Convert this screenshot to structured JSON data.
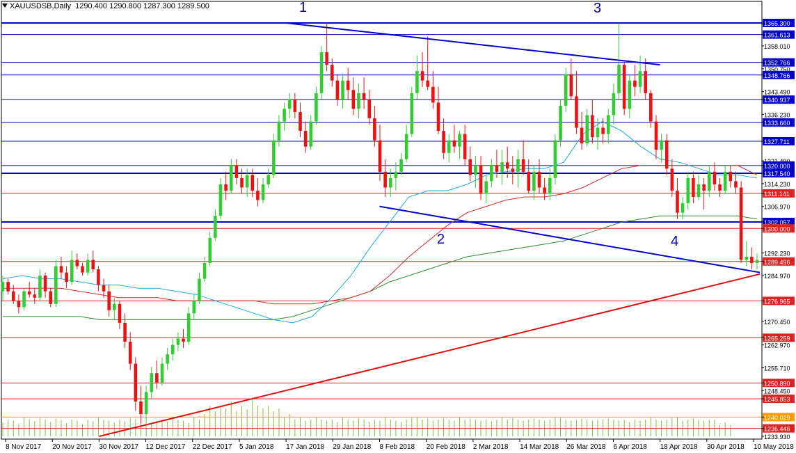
{
  "header": {
    "symbol": "XAUUSDSB,Daily",
    "ohlc": "1290.400 1290.800 1287.300 1289.500"
  },
  "annotations": {
    "a1": "1",
    "a2": "2",
    "a3": "3",
    "a4": "4"
  },
  "chart_data": {
    "type": "candlestick",
    "title": "XAUUSDSB,Daily",
    "ylim": [
      1233.93,
      1365.3
    ],
    "y_ticks": [
      "1365.300",
      "1361.613",
      "1358.010",
      "1352.766",
      "1350.750",
      "1348.766",
      "1343.490",
      "1340.937",
      "1336.230",
      "1333.660",
      "1327.711",
      "1321.490",
      "1320.000",
      "1317.540",
      "1314.230",
      "1311.141",
      "1306.970",
      "1302.057",
      "1300.000",
      "1292.230",
      "1289.496",
      "1284.970",
      "1276.965",
      "1270.450",
      "1265.259",
      "1262.970",
      "1255.710",
      "1250.890",
      "1248.450",
      "1245.853",
      "1240.029",
      "1236.446",
      "1233.930"
    ],
    "x_labels": [
      "8 Nov 2017",
      "20 Nov 2017",
      "30 Nov 2017",
      "12 Dec 2017",
      "22 Dec 2017",
      "5 Jan 2018",
      "17 Jan 2018",
      "29 Jan 2018",
      "8 Feb 2018",
      "20 Feb 2018",
      "2 Mar 2018",
      "14 Mar 2018",
      "26 Mar 2018",
      "6 Apr 2018",
      "18 Apr 2018",
      "30 Apr 2018",
      "10 May 2018"
    ],
    "current_price": 1289.5,
    "horizontal_levels": {
      "blue": [
        1365.3,
        1361.613,
        1352.766,
        1348.766,
        1340.937,
        1333.66,
        1327.711,
        1320.0,
        1317.54,
        1302.057
      ],
      "red": [
        1311.141,
        1300.0,
        1289.496,
        1276.965,
        1265.259,
        1250.89,
        1245.853,
        1236.446
      ],
      "orange": [
        1240.029
      ]
    },
    "trendlines": [
      {
        "color": "blue",
        "from": [
          "17 Jan 2018",
          1365.3
        ],
        "to": [
          "18 Apr 2018",
          1352.0
        ]
      },
      {
        "color": "blue",
        "from": [
          "8 Feb 2018",
          1307.0
        ],
        "to": [
          "17 May 2018",
          1286.0
        ]
      },
      {
        "color": "red",
        "from": [
          "30 Nov 2017",
          1233.9
        ],
        "to": [
          "17 May 2018",
          1285.5
        ]
      }
    ],
    "moving_averages": {
      "colors": {
        "fast": "#1fa9e1",
        "mid": "#d42a2a",
        "slow": "#2e8b2e"
      },
      "fast": [
        1284,
        1285,
        1284,
        1284,
        1283,
        1282,
        1282,
        1281,
        1281,
        1280,
        1279,
        1277,
        1275,
        1273,
        1271,
        1270,
        1272,
        1278,
        1285,
        1294,
        1302,
        1310,
        1312,
        1312,
        1314,
        1317,
        1318,
        1319,
        1319,
        1321,
        1330,
        1334,
        1331,
        1326,
        1322,
        1321,
        1319,
        1317,
        1317,
        1316
      ],
      "mid": [
        1281,
        1281,
        1281,
        1281,
        1280,
        1279,
        1278,
        1278,
        1278,
        1277,
        1277,
        1277,
        1277,
        1277,
        1276,
        1276,
        1276,
        1277,
        1278,
        1280,
        1285,
        1291,
        1296,
        1301,
        1305,
        1307,
        1309,
        1310,
        1310,
        1311,
        1313,
        1316,
        1319,
        1320,
        1320,
        1320,
        1320,
        1320,
        1320,
        1317
      ],
      "slow": [
        1272,
        1272,
        1272,
        1272,
        1272,
        1271,
        1271,
        1271,
        1271,
        1271,
        1271,
        1271,
        1271,
        1271,
        1271,
        1272,
        1274,
        1276,
        1278,
        1280,
        1283,
        1285,
        1287,
        1289,
        1291,
        1292,
        1293,
        1294,
        1295,
        1296,
        1298,
        1300,
        1302,
        1303,
        1304,
        1304,
        1304,
        1304,
        1304,
        1303
      ]
    },
    "candles": [
      [
        1280,
        1285,
        1277,
        1283
      ],
      [
        1283,
        1284,
        1279,
        1280
      ],
      [
        1280,
        1282,
        1276,
        1277
      ],
      [
        1277,
        1279,
        1273,
        1275
      ],
      [
        1275,
        1281,
        1274,
        1280
      ],
      [
        1280,
        1283,
        1278,
        1279
      ],
      [
        1279,
        1281,
        1276,
        1278
      ],
      [
        1278,
        1287,
        1277,
        1285
      ],
      [
        1285,
        1286,
        1278,
        1280
      ],
      [
        1280,
        1281,
        1275,
        1276
      ],
      [
        1276,
        1290,
        1275,
        1288
      ],
      [
        1288,
        1291,
        1284,
        1286
      ],
      [
        1286,
        1288,
        1281,
        1283
      ],
      [
        1283,
        1293,
        1282,
        1290
      ],
      [
        1290,
        1292,
        1287,
        1288
      ],
      [
        1288,
        1289,
        1285,
        1286
      ],
      [
        1286,
        1292,
        1285,
        1290
      ],
      [
        1290,
        1293,
        1286,
        1287
      ],
      [
        1287,
        1288,
        1280,
        1282
      ],
      [
        1282,
        1284,
        1278,
        1280
      ],
      [
        1280,
        1282,
        1272,
        1274
      ],
      [
        1274,
        1278,
        1271,
        1276
      ],
      [
        1276,
        1277,
        1268,
        1270
      ],
      [
        1270,
        1273,
        1262,
        1264
      ],
      [
        1264,
        1267,
        1255,
        1257
      ],
      [
        1257,
        1259,
        1242,
        1245
      ],
      [
        1245,
        1250,
        1238,
        1241
      ],
      [
        1241,
        1250,
        1239,
        1248
      ],
      [
        1248,
        1256,
        1246,
        1254
      ],
      [
        1254,
        1258,
        1249,
        1251
      ],
      [
        1251,
        1259,
        1250,
        1257
      ],
      [
        1257,
        1262,
        1255,
        1260
      ],
      [
        1260,
        1265,
        1258,
        1263
      ],
      [
        1263,
        1267,
        1261,
        1265
      ],
      [
        1265,
        1268,
        1262,
        1264
      ],
      [
        1264,
        1275,
        1263,
        1273
      ],
      [
        1273,
        1279,
        1271,
        1277
      ],
      [
        1277,
        1286,
        1276,
        1284
      ],
      [
        1284,
        1291,
        1283,
        1289
      ],
      [
        1289,
        1299,
        1288,
        1297
      ],
      [
        1297,
        1306,
        1296,
        1304
      ],
      [
        1304,
        1316,
        1303,
        1314
      ],
      [
        1314,
        1318,
        1309,
        1312
      ],
      [
        1312,
        1322,
        1311,
        1320
      ],
      [
        1320,
        1322,
        1314,
        1316
      ],
      [
        1316,
        1319,
        1311,
        1313
      ],
      [
        1313,
        1319,
        1310,
        1317
      ],
      [
        1317,
        1319,
        1310,
        1312
      ],
      [
        1312,
        1316,
        1307,
        1309
      ],
      [
        1309,
        1316,
        1308,
        1314
      ],
      [
        1314,
        1319,
        1313,
        1317
      ],
      [
        1317,
        1330,
        1316,
        1328
      ],
      [
        1328,
        1336,
        1326,
        1334
      ],
      [
        1334,
        1340,
        1331,
        1338
      ],
      [
        1338,
        1343,
        1335,
        1341
      ],
      [
        1341,
        1343,
        1335,
        1337
      ],
      [
        1337,
        1340,
        1329,
        1331
      ],
      [
        1331,
        1334,
        1324,
        1326
      ],
      [
        1326,
        1336,
        1325,
        1334
      ],
      [
        1334,
        1345,
        1333,
        1343
      ],
      [
        1343,
        1358,
        1341,
        1356
      ],
      [
        1356,
        1365,
        1350,
        1352
      ],
      [
        1352,
        1354,
        1345,
        1347
      ],
      [
        1347,
        1349,
        1339,
        1341
      ],
      [
        1341,
        1349,
        1338,
        1347
      ],
      [
        1347,
        1351,
        1341,
        1344
      ],
      [
        1344,
        1348,
        1336,
        1338
      ],
      [
        1338,
        1346,
        1335,
        1343
      ],
      [
        1343,
        1348,
        1338,
        1341
      ],
      [
        1341,
        1344,
        1333,
        1335
      ],
      [
        1335,
        1339,
        1326,
        1328
      ],
      [
        1328,
        1333,
        1315,
        1318
      ],
      [
        1318,
        1322,
        1310,
        1313
      ],
      [
        1313,
        1319,
        1310,
        1316
      ],
      [
        1316,
        1321,
        1312,
        1318
      ],
      [
        1318,
        1324,
        1317,
        1322
      ],
      [
        1322,
        1333,
        1321,
        1330
      ],
      [
        1330,
        1345,
        1329,
        1343
      ],
      [
        1343,
        1355,
        1341,
        1350
      ],
      [
        1350,
        1356,
        1345,
        1347
      ],
      [
        1347,
        1361,
        1344,
        1345
      ],
      [
        1345,
        1350,
        1338,
        1340
      ],
      [
        1340,
        1345,
        1330,
        1331
      ],
      [
        1331,
        1335,
        1322,
        1324
      ],
      [
        1324,
        1330,
        1321,
        1328
      ],
      [
        1328,
        1333,
        1324,
        1326
      ],
      [
        1326,
        1331,
        1322,
        1330
      ],
      [
        1330,
        1333,
        1320,
        1322
      ],
      [
        1322,
        1326,
        1315,
        1317
      ],
      [
        1317,
        1323,
        1313,
        1320
      ],
      [
        1320,
        1323,
        1309,
        1311
      ],
      [
        1311,
        1317,
        1308,
        1315
      ],
      [
        1315,
        1322,
        1313,
        1320
      ],
      [
        1320,
        1325,
        1316,
        1318
      ],
      [
        1318,
        1325,
        1314,
        1321
      ],
      [
        1321,
        1326,
        1316,
        1319
      ],
      [
        1319,
        1323,
        1314,
        1318
      ],
      [
        1318,
        1325,
        1313,
        1322
      ],
      [
        1322,
        1328,
        1317,
        1318
      ],
      [
        1318,
        1322,
        1311,
        1312
      ],
      [
        1312,
        1320,
        1309,
        1318
      ],
      [
        1318,
        1322,
        1311,
        1313
      ],
      [
        1313,
        1316,
        1309,
        1311
      ],
      [
        1311,
        1319,
        1309,
        1316
      ],
      [
        1316,
        1330,
        1314,
        1328
      ],
      [
        1328,
        1341,
        1326,
        1339
      ],
      [
        1339,
        1351,
        1337,
        1349
      ],
      [
        1349,
        1354,
        1341,
        1342
      ],
      [
        1342,
        1350,
        1330,
        1332
      ],
      [
        1332,
        1337,
        1325,
        1327
      ],
      [
        1327,
        1338,
        1326,
        1336
      ],
      [
        1336,
        1341,
        1327,
        1329
      ],
      [
        1329,
        1335,
        1325,
        1332
      ],
      [
        1332,
        1335,
        1327,
        1330
      ],
      [
        1330,
        1338,
        1327,
        1336
      ],
      [
        1336,
        1346,
        1333,
        1343
      ],
      [
        1343,
        1365,
        1341,
        1352
      ],
      [
        1352,
        1353,
        1336,
        1338
      ],
      [
        1338,
        1349,
        1335,
        1347
      ],
      [
        1347,
        1352,
        1342,
        1345
      ],
      [
        1345,
        1355,
        1343,
        1350
      ],
      [
        1350,
        1354,
        1341,
        1343
      ],
      [
        1343,
        1344,
        1332,
        1334
      ],
      [
        1334,
        1336,
        1322,
        1325
      ],
      [
        1325,
        1330,
        1321,
        1328
      ],
      [
        1328,
        1330,
        1317,
        1319
      ],
      [
        1319,
        1322,
        1310,
        1312
      ],
      [
        1312,
        1316,
        1303,
        1305
      ],
      [
        1305,
        1310,
        1303,
        1308
      ],
      [
        1308,
        1318,
        1306,
        1316
      ],
      [
        1316,
        1318,
        1308,
        1310
      ],
      [
        1310,
        1317,
        1309,
        1314
      ],
      [
        1314,
        1316,
        1306,
        1312
      ],
      [
        1312,
        1320,
        1310,
        1318
      ],
      [
        1318,
        1321,
        1312,
        1314
      ],
      [
        1314,
        1316,
        1310,
        1312
      ],
      [
        1312,
        1320,
        1311,
        1318
      ],
      [
        1318,
        1320,
        1313,
        1315
      ],
      [
        1315,
        1318,
        1311,
        1313
      ],
      [
        1313,
        1315,
        1289,
        1290
      ],
      [
        1290,
        1296,
        1288,
        1291
      ],
      [
        1291,
        1294,
        1287,
        1289
      ],
      [
        1289,
        1292,
        1287,
        1290
      ]
    ],
    "volume_heights": [
      0.25,
      0.3,
      0.28,
      0.22,
      0.35,
      0.3,
      0.27,
      0.33,
      0.3,
      0.26,
      0.31,
      0.29,
      0.24,
      0.3,
      0.28,
      0.22,
      0.3,
      0.27,
      0.33,
      0.3,
      0.28,
      0.25,
      0.3,
      0.27,
      0.33,
      0.31,
      0.26,
      0.3,
      0.24,
      0.28,
      0.3,
      0.27,
      0.32,
      0.3,
      0.28,
      0.24,
      0.35,
      0.3,
      0.4,
      0.55,
      0.45,
      0.52,
      0.5,
      0.62,
      0.45,
      0.55,
      0.48,
      0.7,
      0.55,
      0.5,
      0.55,
      0.45,
      0.5,
      0.35,
      0.4,
      0.3,
      0.35,
      0.28,
      0.3,
      0.35,
      0.3,
      0.28,
      0.3,
      0.25,
      0.33,
      0.3,
      0.28,
      0.32,
      0.3,
      0.26,
      0.3,
      0.28,
      0.35,
      0.3,
      0.28,
      0.26,
      0.3,
      0.33,
      0.35,
      0.3,
      0.32,
      0.28,
      0.3,
      0.33,
      0.3,
      0.28,
      0.35,
      0.3,
      0.32,
      0.3,
      0.28,
      0.3,
      0.27,
      0.3,
      0.35,
      0.3,
      0.33,
      0.3,
      0.28,
      0.3,
      0.32,
      0.3,
      0.28,
      0.3,
      0.35,
      0.33,
      0.3,
      0.28,
      0.3,
      0.32,
      0.3,
      0.28,
      0.3,
      0.3,
      0.32,
      0.3,
      0.28,
      0.3,
      0.26,
      0.3,
      0.28,
      0.3,
      0.35,
      0.3,
      0.28,
      0.3,
      0.33,
      0.35,
      0.28,
      0.3,
      0.32,
      0.3,
      0.28,
      0.3,
      0.3,
      0.2,
      0.25,
      0.2
    ]
  }
}
